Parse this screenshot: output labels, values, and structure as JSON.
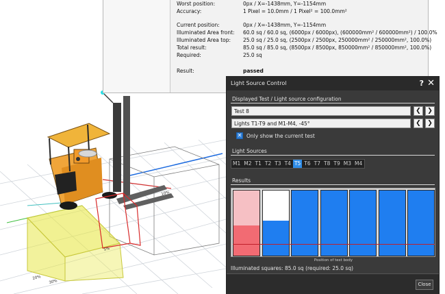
{
  "info_panel": {
    "rows": [
      {
        "label": "Worst position:",
        "value": "0px   / X=-1438mm, Y=-1154mm"
      },
      {
        "label": "Accuracy:",
        "value": "1 Pixel = 10.0mm  /  1 Pixel² = 100.0mm²"
      },
      {
        "label": "Current position:",
        "value": "0px   / X=-1438mm, Y=-1154mm"
      },
      {
        "label": "Illuminated Area front:",
        "value": "60.0 sq / 60.0 sq, (6000px / 6000px), (600000mm² / 600000mm²) / 100.0%"
      },
      {
        "label": "Illuminated Area top:",
        "value": "25.0 sq / 25.0 sq, (2500px / 2500px, 250000mm² / 250000mm², 100.0%)"
      },
      {
        "label": "Total result:",
        "value": "85.0 sq / 85.0 sq, (8500px / 8500px, 850000mm² / 850000mm², 100.0%)"
      },
      {
        "label": "Required:",
        "value": "25.0 sq"
      },
      {
        "label": "Result:",
        "value": "passed"
      }
    ]
  },
  "dialog": {
    "title": "Light Source Control",
    "help_label": "?",
    "close_x_label": "✕",
    "section_displayed": "Displayed Test / Light source configuration",
    "test_combo_value": "Test 8",
    "config_combo_value": "Lights T1-T9 and M1-M4, -45°",
    "prev_label": "❮",
    "next_label": "❯",
    "checkbox_checked": "✕",
    "checkbox_label": "Only show the current test",
    "section_light_sources": "Light Sources",
    "light_sources": [
      "M1",
      "M2",
      "T1",
      "T2",
      "T3",
      "T4",
      "T5",
      "T6",
      "T7",
      "T8",
      "T9",
      "M3",
      "M4"
    ],
    "active_light_source": "T5",
    "section_results": "Results",
    "results_fill": [
      {
        "top_fill": 0.54,
        "bottom_fill": 0.46,
        "top_color": "#f6c0c4",
        "bottom_color": "#f26b73"
      },
      {
        "top_fill": 0.46,
        "bottom_fill": 0.54,
        "top_color": "#ffffff",
        "bottom_color": "#1f7ef0"
      },
      {
        "top_fill": 0.0,
        "bottom_fill": 1.0,
        "top_color": "#ffffff",
        "bottom_color": "#1f7ef0"
      },
      {
        "top_fill": 0.0,
        "bottom_fill": 1.0,
        "top_color": "#ffffff",
        "bottom_color": "#1f7ef0"
      },
      {
        "top_fill": 0.0,
        "bottom_fill": 1.0,
        "top_color": "#ffffff",
        "bottom_color": "#1f7ef0"
      },
      {
        "top_fill": 0.0,
        "bottom_fill": 1.0,
        "top_color": "#ffffff",
        "bottom_color": "#1f7ef0"
      },
      {
        "top_fill": 0.0,
        "bottom_fill": 1.0,
        "top_color": "#ffffff",
        "bottom_color": "#1f7ef0"
      }
    ],
    "required_level": 0.17,
    "position_label": "Position of test body",
    "illuminated_summary": "Illuminated squares: 85.0 sq (required: 25.0 sq)",
    "close_button_label": "Close"
  },
  "viewport": {
    "floor_labels": [
      "20%",
      "30%",
      "5%",
      "10%"
    ]
  }
}
